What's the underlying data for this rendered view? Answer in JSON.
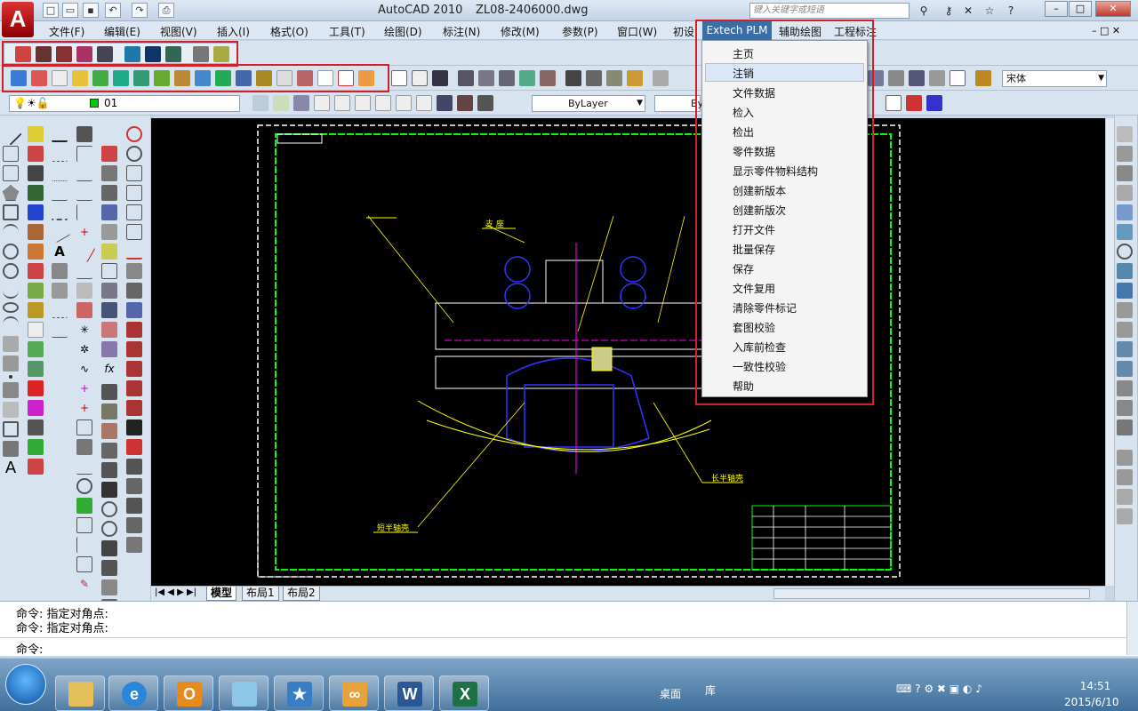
{
  "window": {
    "app_title": "AutoCAD 2010",
    "file_name": "ZL08-2406000.dwg",
    "search_placeholder": "键入关键字或短语"
  },
  "menu": [
    {
      "label": "文件(F)"
    },
    {
      "label": "编辑(E)"
    },
    {
      "label": "视图(V)"
    },
    {
      "label": "插入(I)"
    },
    {
      "label": "格式(O)"
    },
    {
      "label": "工具(T)"
    },
    {
      "label": "绘图(D)"
    },
    {
      "label": "标注(N)"
    },
    {
      "label": "修改(M)"
    },
    {
      "label": "参数(P)"
    },
    {
      "label": "窗口(W)"
    },
    {
      "label": "初设"
    }
  ],
  "menu_open": "Extech PLM",
  "menu_right": [
    {
      "label": "辅助绘图"
    },
    {
      "label": "工程标注"
    }
  ],
  "plm_menu": {
    "items": [
      "主页",
      "注销",
      "文件数据",
      "检入",
      "检出",
      "零件数据",
      "显示零件物料结构",
      "创建新版本",
      "创建新版次",
      "打开文件",
      "批量保存",
      "保存",
      "文件复用",
      "清除零件标记",
      "套图校验",
      "入库前检查",
      "一致性校验",
      "帮助"
    ],
    "highlighted_index": 1
  },
  "toolbar": {
    "layer_value": "01",
    "bylayer_value": "ByLayer",
    "bylayer2_prefix": "By",
    "font_value": "宋体"
  },
  "layout_tabs": [
    "模型",
    "布局1",
    "布局2"
  ],
  "command": {
    "line1": "命令: 指定对角点:",
    "line2": "命令: 指定对角点:",
    "prompt": "命令:"
  },
  "drawing_labels": {
    "label_a": "支 座",
    "label_b": "长半轴壳",
    "label_c": "短半轴壳"
  },
  "taskbar": {
    "desktop_label": "桌面",
    "library_label": "库",
    "time": "14:51",
    "date": "2015/6/10"
  },
  "colors": {
    "accent": "#3a6ea5",
    "highlight_box": "#d0202a",
    "canvas": "#000000"
  }
}
